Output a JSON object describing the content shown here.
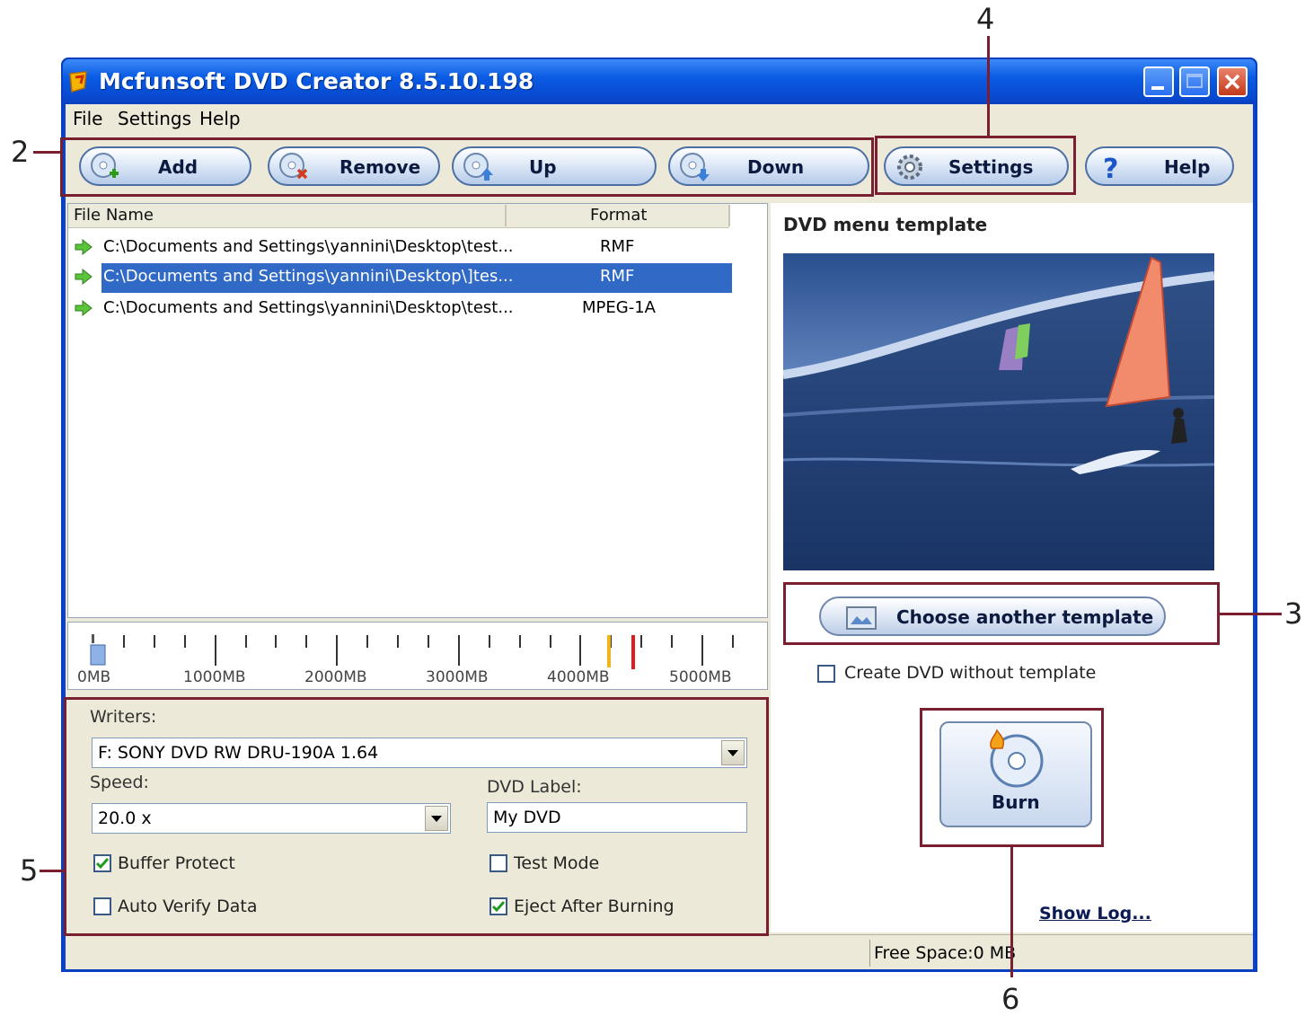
{
  "window": {
    "title": "Mcfunsoft DVD Creator 8.5.10.198"
  },
  "menu": [
    "File",
    "Settings",
    "Help"
  ],
  "toolbar": {
    "add": "Add",
    "remove": "Remove",
    "up": "Up",
    "down": "Down",
    "settings": "Settings",
    "help": "Help"
  },
  "file_list": {
    "headers": [
      "File Name",
      "Format"
    ],
    "rows": [
      {
        "name": "C:\\Documents and Settings\\yannini\\Desktop\\test...",
        "format": "RMF",
        "selected": false
      },
      {
        "name": "C:\\Documents and Settings\\yannini\\Desktop\\]tes...",
        "format": "RMF",
        "selected": true
      },
      {
        "name": "C:\\Documents and Settings\\yannini\\Desktop\\test...",
        "format": "MPEG-1A",
        "selected": false
      }
    ]
  },
  "meter": {
    "labels": [
      "0MB",
      "1000MB",
      "2000MB",
      "3000MB",
      "4000MB",
      "5000MB"
    ]
  },
  "template": {
    "title": "DVD menu template",
    "choose_button": "Choose another template",
    "without_template_label": "Create DVD without template",
    "without_template_checked": false
  },
  "writer": {
    "writers_label": "Writers:",
    "writer_value": "F: SONY DVD RW DRU-190A 1.64",
    "speed_label": "Speed:",
    "speed_value": "20.0 x",
    "dvd_label_label": "DVD Label:",
    "dvd_label_value": "My DVD",
    "buffer_protect": "Buffer Protect",
    "buffer_protect_checked": true,
    "auto_verify": "Auto Verify Data",
    "auto_verify_checked": false,
    "test_mode": "Test Mode",
    "test_mode_checked": false,
    "eject_after": "Eject After Burning",
    "eject_after_checked": true
  },
  "burn": {
    "label": "Burn"
  },
  "show_log": "Show Log...",
  "status": {
    "free_space": "Free Space:0 MB"
  },
  "callouts": {
    "two": "2",
    "three": "3",
    "four": "4",
    "five": "5",
    "six": "6"
  },
  "colors": {
    "highlight": "#7a1f2f",
    "selection": "#3169c6",
    "titlebar": "#0a5be4"
  }
}
